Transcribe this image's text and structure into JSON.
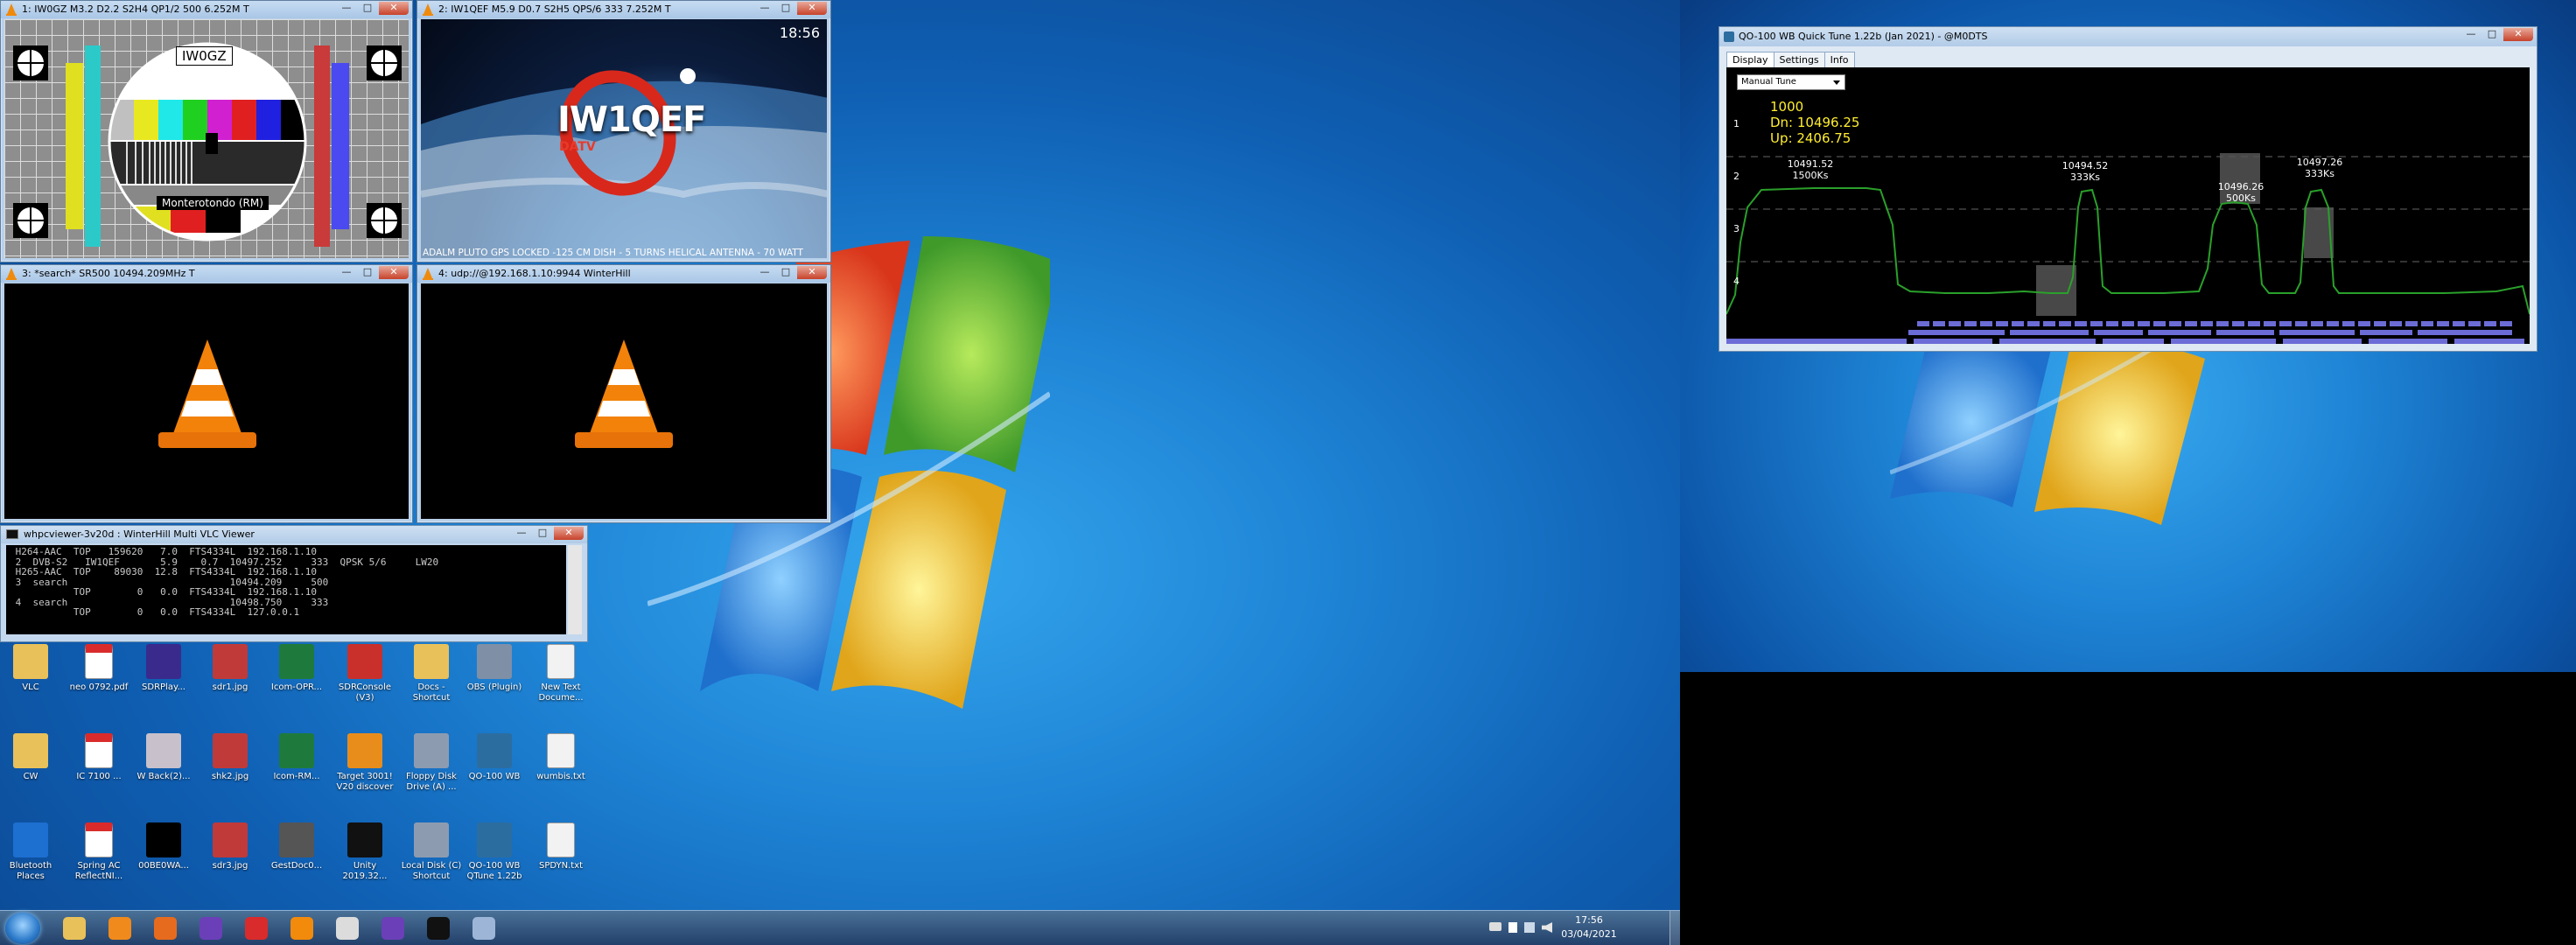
{
  "vlc": {
    "w1": {
      "title": "1: IW0GZ M3.2 D2.2 S2H4 QP1/2 500 6.252M T",
      "card_callsign": "IW0GZ",
      "card_location": "Monterotondo (RM)"
    },
    "w2": {
      "title": "2: IW1QEF M5.9 D0.7 S2H5 QPS/6 333 7.252M T",
      "time": "18:56",
      "logo": "IW1QEF",
      "logo_sub": "DATV",
      "ticker": "ADALM PLUTO GPS LOCKED -125 CM DISH - 5 TURNS HELICAL ANTENNA - 70 WATT"
    },
    "w3": {
      "title": "3: *search* SR500 10494.209MHz T"
    },
    "w4": {
      "title": "4: udp://@192.168.1.10:9944  WinterHill"
    },
    "controls": {
      "min": "—",
      "max": "□",
      "close": "✕"
    }
  },
  "console": {
    "title": "whpcviewer-3v20d : WinterHill Multi VLC Viewer",
    "lines": [
      " H264-AAC  TOP   159620   7.0  FTS4334L  192.168.1.10",
      " 2  DVB-S2   IW1QEF       5.9    0.7  10497.252     333  QPSK 5/6     LW20",
      " H265-AAC  TOP    89030  12.8  FTS4334L  192.168.1.10",
      " 3  search                            10494.209     500",
      "           TOP        0   0.0  FTS4334L  192.168.1.10",
      " 4  search                            10498.750     333",
      "           TOP        0   0.0  FTS4334L  127.0.0.1"
    ]
  },
  "quicktune": {
    "title": "QO-100 WB Quick Tune 1.22b (Jan 2021) - @M0DTS",
    "tabs": [
      "Display",
      "Settings",
      "Info"
    ],
    "mode": "Manual Tune",
    "sr": "1000",
    "dn": "Dn: 10496.25",
    "up": "Up: 2406.75",
    "rows": [
      "1",
      "2",
      "3",
      "4"
    ],
    "signals": [
      {
        "freq": "10491.52",
        "rate": "1500Ks"
      },
      {
        "freq": "10494.52",
        "rate": "333Ks"
      },
      {
        "freq": "10496.26",
        "rate": "500Ks"
      },
      {
        "freq": "10497.26",
        "rate": "333Ks"
      }
    ]
  },
  "desktop_icons": [
    {
      "label": "VLC",
      "icon": "folder-icon",
      "color": "#e8c15a"
    },
    {
      "label": "neo 0792.pdf",
      "icon": "pdf-icon",
      "color": "#d92b2b"
    },
    {
      "label": "SDRPlay...",
      "icon": "app-icon",
      "color": "#3a2a8c"
    },
    {
      "label": "sdr1.jpg",
      "icon": "image-icon",
      "color": "#c03a3a"
    },
    {
      "label": "Icom-OPR...",
      "icon": "excel-icon",
      "color": "#1e7a3c"
    },
    {
      "label": "SDRConsole (V3)",
      "icon": "radio-icon",
      "color": "#c9302c"
    },
    {
      "label": "Docs - Shortcut",
      "icon": "folder-icon",
      "color": "#e8c15a"
    },
    {
      "label": "OBS (Plugin)",
      "icon": "gear-icon",
      "color": "#7f8fa6"
    },
    {
      "label": "New Text Docume...",
      "icon": "file-icon",
      "color": "#f2f2f2"
    },
    {
      "label": "CW",
      "icon": "folder-icon",
      "color": "#e8c15a"
    },
    {
      "label": "IC 7100 ...",
      "icon": "pdf-icon",
      "color": "#d92b2b"
    },
    {
      "label": "W Back(2)...",
      "icon": "image-icon",
      "color": "#c8c0ca"
    },
    {
      "label": "shk2.jpg",
      "icon": "image-icon",
      "color": "#c03a3a"
    },
    {
      "label": "Icom-RM...",
      "icon": "excel-icon",
      "color": "#1e7a3c"
    },
    {
      "label": "Target 3001! V20 discover",
      "icon": "app-icon",
      "color": "#e88c1c"
    },
    {
      "label": "Floppy Disk Drive (A) ...",
      "icon": "drive-icon",
      "color": "#8d9bb0"
    },
    {
      "label": "QO-100 WB",
      "icon": "app-icon",
      "color": "#2c6da0"
    },
    {
      "label": "wumbis.txt",
      "icon": "file-icon",
      "color": "#f2f2f2"
    },
    {
      "label": "Bluetooth Places",
      "icon": "bluetooth-icon",
      "color": "#1d6fd0"
    },
    {
      "label": "Spring AC ReflectNI...",
      "icon": "pdf-icon",
      "color": "#d92b2b"
    },
    {
      "label": "00BE0WA...",
      "icon": "image-icon",
      "color": "#000000"
    },
    {
      "label": "sdr3.jpg",
      "icon": "image-icon",
      "color": "#c03a3a"
    },
    {
      "label": "GestDoc0...",
      "icon": "app-icon",
      "color": "#555555"
    },
    {
      "label": "Unity 2019.32...",
      "icon": "unity-icon",
      "color": "#111111"
    },
    {
      "label": "Local Disk (C) Shortcut",
      "icon": "drive-icon",
      "color": "#8d9bb0"
    },
    {
      "label": "QO-100 WB QTune 1.22b",
      "icon": "app-icon",
      "color": "#2c6da0"
    },
    {
      "label": "SPDYN.txt",
      "icon": "file-icon",
      "color": "#f2f2f2"
    }
  ],
  "taskbar": {
    "buttons": [
      {
        "name": "explorer-icon",
        "color": "#e8c15a"
      },
      {
        "name": "media-player-icon",
        "color": "#f08a1c"
      },
      {
        "name": "firefox-icon",
        "color": "#e66b1e"
      },
      {
        "name": "app-purple-icon",
        "color": "#6b3fb8"
      },
      {
        "name": "acrobat-icon",
        "color": "#d92b2b"
      },
      {
        "name": "vlc-icon",
        "color": "#f28a0c"
      },
      {
        "name": "window-icon",
        "color": "#dcdcdc"
      },
      {
        "name": "app-purple2-icon",
        "color": "#6b3fb8"
      },
      {
        "name": "cmd-icon",
        "color": "#111111"
      },
      {
        "name": "control-panel-icon",
        "color": "#9db6d8"
      }
    ],
    "time": "17:56",
    "date": "03/04/2021"
  }
}
